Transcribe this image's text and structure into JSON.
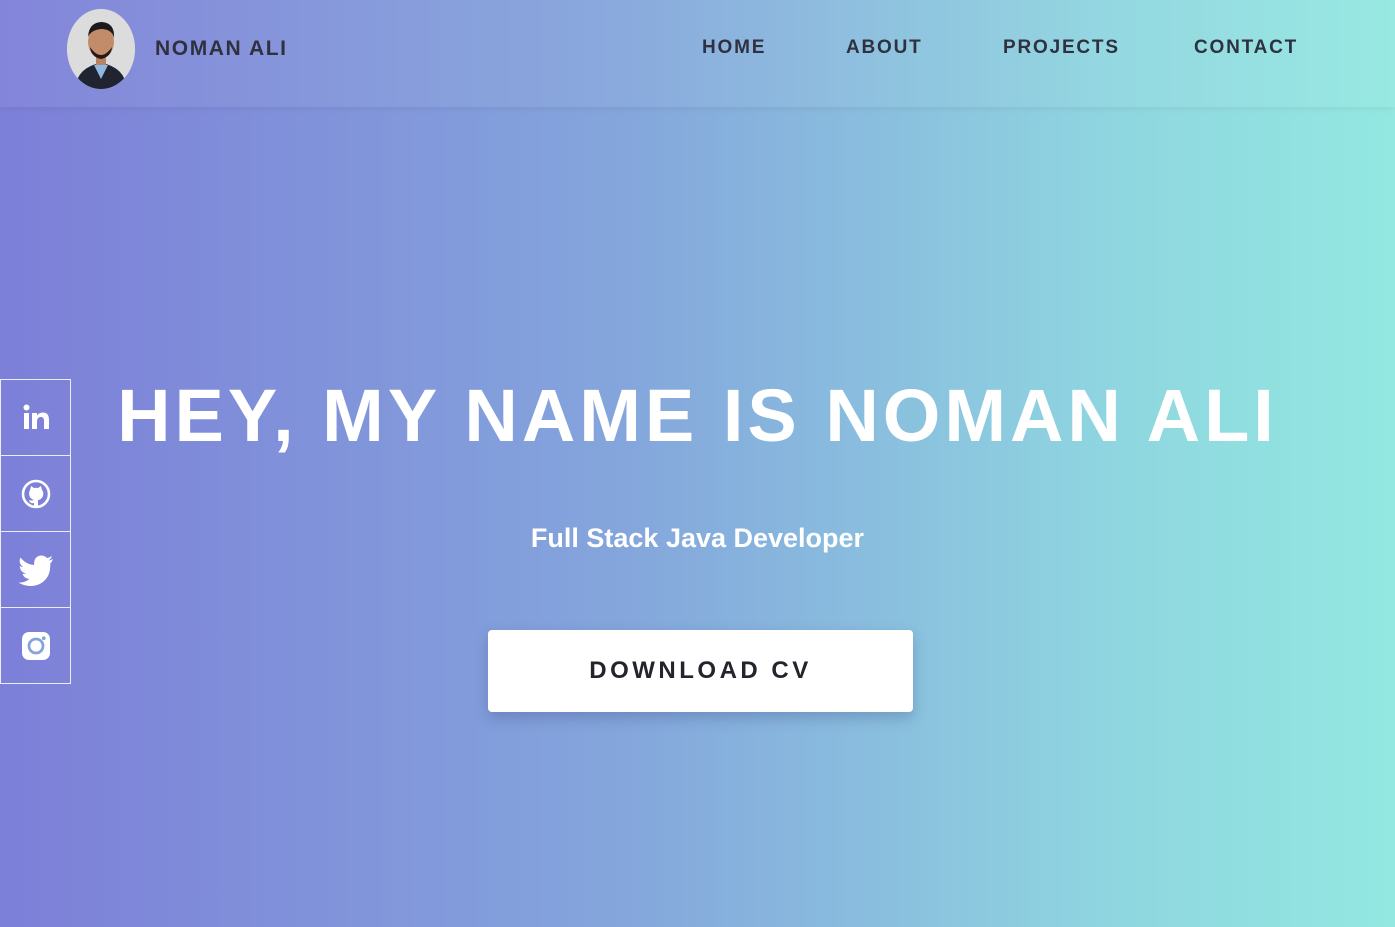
{
  "brand": {
    "name": "NOMAN ALI"
  },
  "nav": {
    "items": [
      {
        "label": "HOME"
      },
      {
        "label": "ABOUT"
      },
      {
        "label": "PROJECTS"
      },
      {
        "label": "CONTACT"
      }
    ]
  },
  "socials": [
    {
      "icon": "linkedin-icon"
    },
    {
      "icon": "github-icon"
    },
    {
      "icon": "twitter-icon"
    },
    {
      "icon": "instagram-icon"
    }
  ],
  "hero": {
    "title": "HEY, MY NAME IS NOMAN ALI",
    "subtitle": "Full Stack Java Developer",
    "cta_label": "DOWNLOAD CV"
  },
  "colors": {
    "gradient_start": "#7d7fd8",
    "gradient_end": "#93e8e1",
    "text_dark": "#2f3140",
    "text_light": "#ffffff"
  }
}
